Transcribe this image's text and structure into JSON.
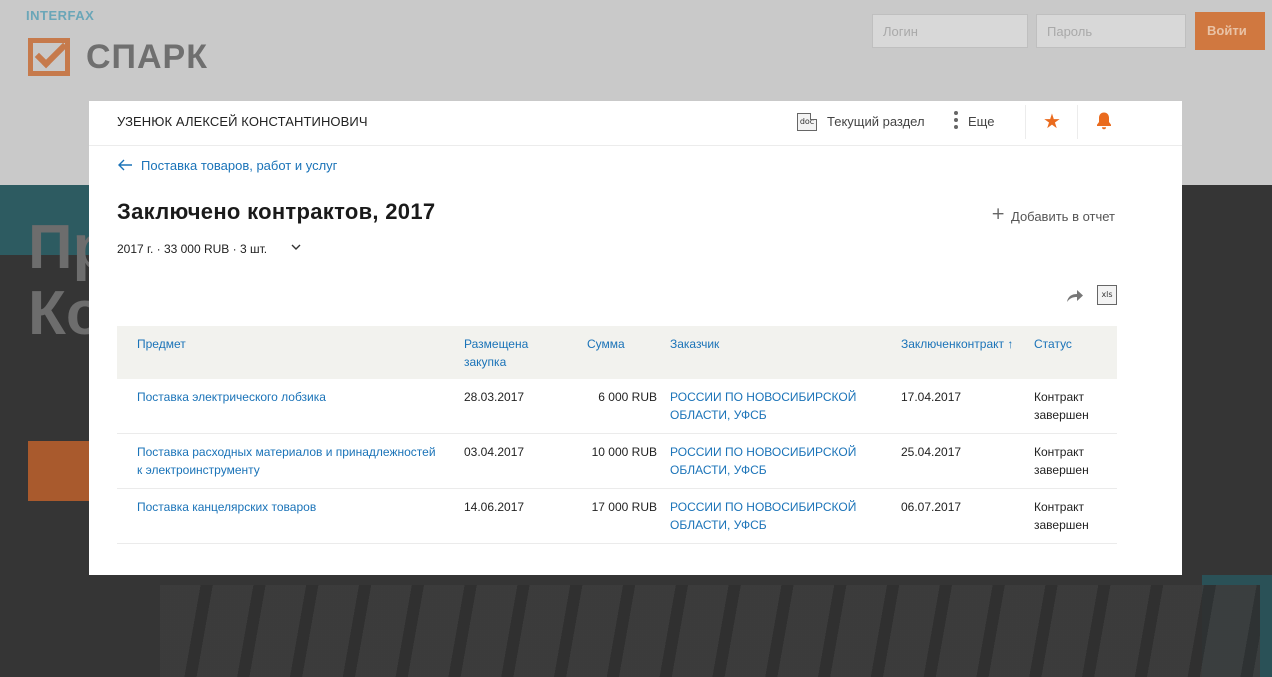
{
  "background": {
    "logo_small": "INTERFAX",
    "logo": "СПАРК",
    "login_placeholder": "Логин",
    "password_placeholder": "Пароль",
    "enter_label": "Войти",
    "hero_title_line1": "Пр",
    "hero_title_line2": "Ко"
  },
  "topbar": {
    "person_name": "УЗЕНЮК АЛЕКСЕЙ КОНСТАНТИНОВИЧ",
    "doc_icon_label": "doc",
    "current_section_label": "Текущий раздел",
    "more_label": "Еще"
  },
  "breadcrumb": {
    "back_label": "Поставка товаров, работ и услуг"
  },
  "page": {
    "title": "Заключено контрактов, 2017",
    "add_to_report_label": "Добавить в отчет",
    "summary": "2017 г. · 33 000 RUB · 3 шт.",
    "xls_icon_label": "xls"
  },
  "table": {
    "columns": {
      "subject": "Предмет",
      "published_line1": "Размещена",
      "published_line2": "закупка",
      "sum": "Сумма",
      "customer": "Заказчик",
      "concluded": "Заключенконтракт ↑",
      "status": "Статус"
    },
    "rows": [
      {
        "subject": "Поставка электрического лобзика",
        "published": "28.03.2017",
        "sum": "6 000 RUB",
        "customer": "РОССИИ ПО НОВОСИБИРСКОЙ ОБЛАСТИ, УФСБ",
        "concluded": "17.04.2017",
        "status": "Контракт завершен"
      },
      {
        "subject": "Поставка расходных материалов и принадлежностей к электроинструменту",
        "published": "03.04.2017",
        "sum": "10 000 RUB",
        "customer": "РОССИИ ПО НОВОСИБИРСКОЙ ОБЛАСТИ, УФСБ",
        "concluded": "25.04.2017",
        "status": "Контракт завершен"
      },
      {
        "subject": "Поставка канцелярских товаров",
        "published": "14.06.2017",
        "sum": "17 000 RUB",
        "customer": "РОССИИ ПО НОВОСИБИРСКОЙ ОБЛАСТИ, УФСБ",
        "concluded": "06.07.2017",
        "status": "Контракт завершен"
      }
    ]
  },
  "colors": {
    "accent_orange": "#ea6b1e",
    "link_blue": "#1a73b8"
  }
}
